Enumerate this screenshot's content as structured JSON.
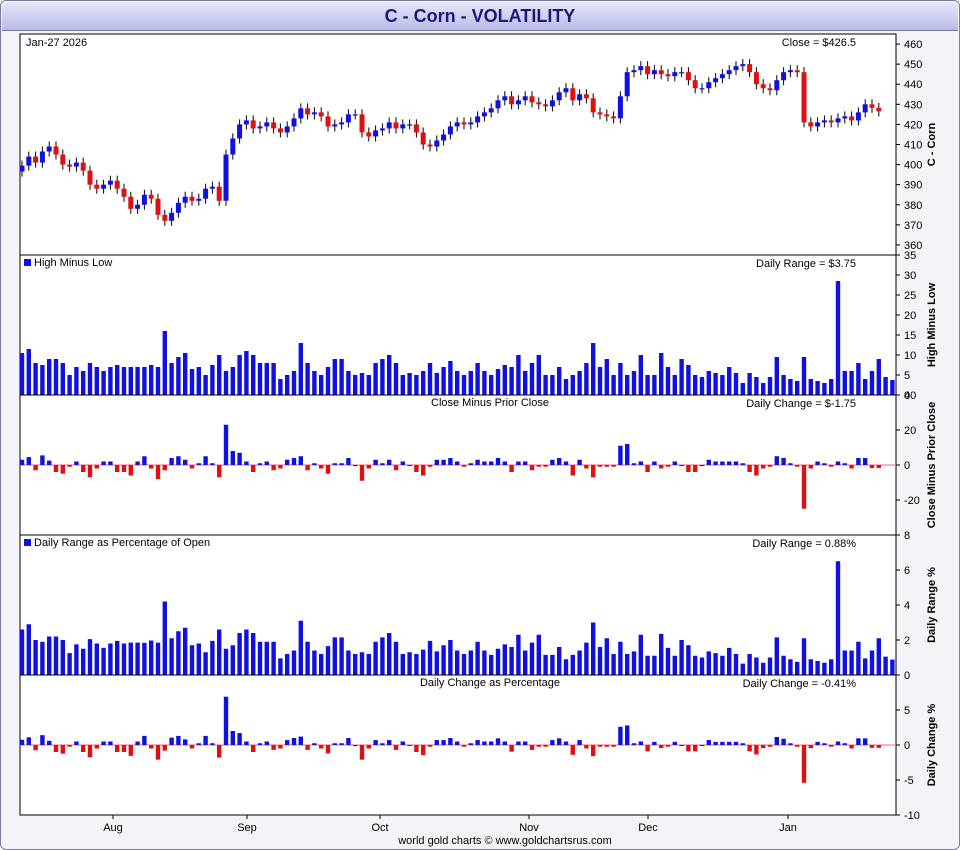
{
  "title": "C  -  Corn - VOLATILITY",
  "footer": "world gold charts © www.goldchartsrus.com",
  "colors": {
    "up": "#1010e0",
    "down": "#e01010",
    "frame": "#000000"
  },
  "chart_data": {
    "type": "candlestick-and-bar",
    "date_label": "Jan-27  2026",
    "x_axis_labels": [
      "Aug",
      "Sep",
      "Oct",
      "Nov",
      "Dec",
      "Jan"
    ],
    "panels": [
      {
        "id": "price",
        "type": "candlestick",
        "ylabel": "C  -  Corn",
        "right_note": "Close = $426.5",
        "ylim": [
          355,
          465
        ],
        "yticks": [
          360,
          370,
          380,
          390,
          400,
          410,
          420,
          430,
          440,
          450,
          460
        ],
        "closes": [
          399.5,
          404.0,
          401.0,
          406.5,
          409.0,
          405.0,
          400.0,
          399.0,
          401.0,
          397.0,
          390.0,
          388.0,
          390.0,
          392.0,
          388.0,
          384.0,
          378.0,
          380.0,
          385.0,
          383.0,
          375.0,
          372.0,
          376.0,
          381.0,
          384.0,
          382.0,
          383.0,
          388.0,
          389.0,
          382.0,
          405.0,
          413.0,
          420.0,
          422.0,
          418.0,
          419.0,
          421.0,
          418.0,
          416.0,
          419.0,
          423.0,
          428.0,
          425.0,
          426.0,
          424.0,
          419.0,
          420.0,
          421.0,
          425.0,
          425.0,
          416.0,
          414.0,
          417.0,
          418.0,
          421.0,
          418.0,
          420.0,
          420.0,
          416.0,
          410.0,
          409.0,
          412.0,
          415.0,
          419.0,
          421.0,
          420.0,
          421.0,
          424.0,
          426.0,
          428.0,
          432.0,
          434.0,
          430.0,
          432.0,
          434.0,
          431.0,
          430.0,
          429.0,
          432.0,
          436.0,
          438.0,
          432.0,
          435.0,
          433.0,
          426.0,
          425.0,
          424.0,
          423.0,
          434.0,
          446.0,
          447.0,
          449.0,
          445.0,
          447.0,
          445.0,
          444.0,
          446.0,
          446.0,
          442.0,
          438.0,
          438.0,
          441.0,
          443.0,
          445.0,
          447.0,
          449.0,
          450.0,
          446.0,
          440.0,
          438.0,
          437.0,
          442.0,
          446.0,
          447.0,
          446.0,
          421.0,
          419.0,
          421.0,
          422.0,
          421.0,
          423.0,
          424.0,
          422.0,
          426.0,
          430.0,
          428.25,
          426.5
        ],
        "opens_note": "open = prior close; up candles blue, down candles red"
      },
      {
        "id": "hml",
        "type": "bar",
        "legend": "High Minus Low",
        "ylabel": "High Minus Low",
        "right_note": "Daily Range = $3.75",
        "ylim": [
          0,
          35
        ],
        "yticks": [
          0,
          5,
          10,
          15,
          20,
          25,
          30,
          35
        ],
        "values": [
          10.5,
          11.5,
          8.0,
          7.5,
          9.0,
          9.0,
          8.0,
          5.0,
          7.0,
          6.0,
          8.0,
          7.0,
          6.0,
          7.0,
          7.5,
          7.0,
          7.0,
          7.0,
          7.0,
          7.5,
          7.0,
          16.0,
          8.0,
          9.5,
          10.5,
          6.5,
          7.0,
          5.0,
          7.5,
          10.0,
          6.0,
          7.0,
          10.0,
          11.0,
          10.0,
          8.0,
          8.0,
          8.0,
          4.0,
          5.0,
          6.0,
          13.0,
          8.0,
          6.0,
          5.0,
          7.0,
          9.0,
          9.0,
          6.0,
          5.0,
          5.5,
          5.0,
          8.0,
          9.0,
          10.0,
          8.0,
          5.0,
          5.5,
          5.0,
          6.0,
          8.0,
          5.5,
          7.0,
          8.5,
          6.0,
          5.0,
          6.0,
          8.0,
          6.0,
          5.0,
          6.5,
          7.5,
          7.0,
          10.0,
          6.0,
          8.0,
          10.0,
          5.0,
          5.0,
          7.0,
          4.0,
          5.0,
          6.0,
          8.0,
          13.0,
          7.0,
          9.0,
          5.0,
          8.0,
          5.0,
          6.0,
          10.0,
          5.0,
          5.0,
          10.5,
          7.0,
          5.0,
          9.0,
          7.5,
          5.0,
          4.5,
          6.0,
          5.5,
          5.0,
          7.0,
          5.5,
          3.0,
          5.5,
          4.5,
          3.0,
          4.5,
          9.5,
          5.0,
          4.0,
          3.5,
          9.5,
          4.0,
          3.5,
          3.0,
          4.0,
          28.5,
          6.0,
          6.0,
          8.0,
          4.0,
          6.0,
          9.0,
          4.5,
          3.75
        ]
      },
      {
        "id": "cmpc",
        "type": "bar",
        "legend": "Close Minus Prior Close",
        "ylabel": "Close Minus Prior Close",
        "right_note": "Daily Change = $-1.75",
        "ylim": [
          -40,
          40
        ],
        "yticks": [
          -20,
          0,
          20,
          40
        ],
        "values": [
          3.0,
          4.5,
          -3.0,
          5.5,
          2.5,
          -4.0,
          -5.0,
          -1.0,
          2.0,
          -4.0,
          -7.0,
          -2.0,
          2.0,
          2.0,
          -4.0,
          -4.0,
          -6.0,
          2.0,
          5.0,
          -2.0,
          -8.0,
          -3.0,
          4.0,
          5.0,
          3.0,
          -2.0,
          1.0,
          5.0,
          1.0,
          -7.0,
          23.0,
          8.0,
          7.0,
          2.0,
          -4.0,
          1.0,
          2.0,
          -3.0,
          -2.0,
          3.0,
          4.0,
          5.0,
          -3.0,
          1.0,
          -2.0,
          -5.0,
          1.0,
          1.0,
          4.0,
          0.0,
          -9.0,
          -2.0,
          3.0,
          1.0,
          3.0,
          -3.0,
          2.0,
          0.0,
          -4.0,
          -6.0,
          -1.0,
          3.0,
          3.0,
          4.0,
          2.0,
          -1.0,
          1.0,
          3.0,
          2.0,
          2.0,
          4.0,
          2.0,
          -4.0,
          2.0,
          2.0,
          -3.0,
          -1.0,
          -1.0,
          3.0,
          4.0,
          2.0,
          -6.0,
          3.0,
          -2.0,
          -7.0,
          -1.0,
          -1.0,
          -1.0,
          11.0,
          12.0,
          1.0,
          2.0,
          -4.0,
          2.0,
          -2.0,
          -1.0,
          2.0,
          0.0,
          -4.0,
          -4.0,
          0.0,
          3.0,
          2.0,
          2.0,
          2.0,
          2.0,
          1.0,
          -4.0,
          -6.0,
          -2.0,
          -1.0,
          5.0,
          4.0,
          1.0,
          -1.0,
          -25.0,
          -2.0,
          2.0,
          1.0,
          -1.0,
          2.0,
          1.0,
          -2.0,
          4.0,
          4.0,
          -1.75,
          -1.75
        ]
      },
      {
        "id": "rpct",
        "type": "bar",
        "legend": "Daily Range as Percentage of Open",
        "ylabel": "Daily Range %",
        "right_note": "Daily Range = 0.88%",
        "ylim": [
          0,
          8
        ],
        "yticks": [
          0,
          2,
          4,
          6,
          8
        ],
        "values": [
          2.6,
          2.9,
          2.0,
          1.9,
          2.2,
          2.2,
          2.0,
          1.25,
          1.75,
          1.5,
          2.05,
          1.8,
          1.55,
          1.8,
          1.95,
          1.8,
          1.85,
          1.85,
          1.84,
          1.97,
          1.85,
          4.2,
          2.1,
          2.5,
          2.7,
          1.7,
          1.8,
          1.3,
          1.95,
          2.6,
          1.5,
          1.7,
          2.4,
          2.6,
          2.4,
          1.9,
          1.9,
          1.9,
          0.95,
          1.2,
          1.4,
          3.1,
          1.9,
          1.4,
          1.2,
          1.65,
          2.15,
          2.15,
          1.4,
          1.2,
          1.3,
          1.2,
          1.9,
          2.15,
          2.4,
          1.9,
          1.2,
          1.3,
          1.2,
          1.45,
          1.95,
          1.35,
          1.7,
          2.0,
          1.4,
          1.2,
          1.4,
          1.9,
          1.4,
          1.15,
          1.5,
          1.75,
          1.6,
          2.3,
          1.4,
          1.85,
          2.3,
          1.15,
          1.15,
          1.6,
          0.9,
          1.15,
          1.4,
          1.85,
          3.0,
          1.6,
          2.1,
          1.2,
          1.9,
          1.2,
          1.35,
          2.3,
          1.1,
          1.1,
          2.35,
          1.55,
          1.1,
          2.0,
          1.7,
          1.1,
          1.0,
          1.35,
          1.25,
          1.1,
          1.55,
          1.2,
          0.65,
          1.2,
          1.0,
          0.7,
          1.0,
          2.15,
          1.1,
          0.9,
          0.75,
          2.1,
          0.9,
          0.8,
          0.7,
          0.9,
          6.5,
          1.4,
          1.4,
          1.9,
          0.95,
          1.4,
          2.1,
          1.05,
          0.88
        ]
      },
      {
        "id": "cpct",
        "type": "bar",
        "legend": "Daily Change as Percentage",
        "ylabel": "Daily Change %",
        "right_note": "Daily Change = -0.41%",
        "ylim": [
          -10,
          10
        ],
        "yticks": [
          -10,
          -5,
          0,
          5
        ],
        "values": [
          0.75,
          1.1,
          -0.75,
          1.4,
          0.6,
          -1.0,
          -1.25,
          -0.25,
          0.5,
          -1.0,
          -1.75,
          -0.5,
          0.5,
          0.5,
          -1.0,
          -1.0,
          -1.55,
          0.5,
          1.3,
          -0.5,
          -2.1,
          -0.8,
          1.05,
          1.3,
          0.8,
          -0.5,
          0.25,
          1.3,
          0.25,
          -1.8,
          6.9,
          2.0,
          1.7,
          0.5,
          -1.0,
          0.25,
          0.5,
          -0.7,
          -0.5,
          0.7,
          1.0,
          1.2,
          -0.7,
          0.25,
          -0.5,
          -1.2,
          0.25,
          0.25,
          1.0,
          0.0,
          -2.1,
          -0.5,
          0.7,
          0.25,
          0.7,
          -0.7,
          0.5,
          0.0,
          -1.0,
          -1.45,
          -0.25,
          0.7,
          0.7,
          1.0,
          0.5,
          -0.25,
          0.25,
          0.7,
          0.5,
          0.5,
          0.95,
          0.5,
          -0.95,
          0.5,
          0.5,
          -0.7,
          -0.25,
          -0.25,
          0.7,
          0.95,
          0.5,
          -1.4,
          0.7,
          -0.5,
          -1.6,
          -0.25,
          -0.25,
          -0.25,
          2.6,
          2.8,
          0.25,
          0.5,
          -0.9,
          0.45,
          -0.45,
          -0.25,
          0.45,
          0.0,
          -0.9,
          -0.9,
          0.0,
          0.7,
          0.45,
          0.45,
          0.45,
          0.45,
          0.25,
          -0.9,
          -1.35,
          -0.45,
          -0.25,
          1.15,
          0.9,
          0.25,
          -0.25,
          -5.4,
          -0.45,
          0.45,
          0.25,
          -0.25,
          0.5,
          0.25,
          -0.5,
          0.95,
          0.95,
          -0.41,
          -0.41
        ]
      }
    ]
  }
}
